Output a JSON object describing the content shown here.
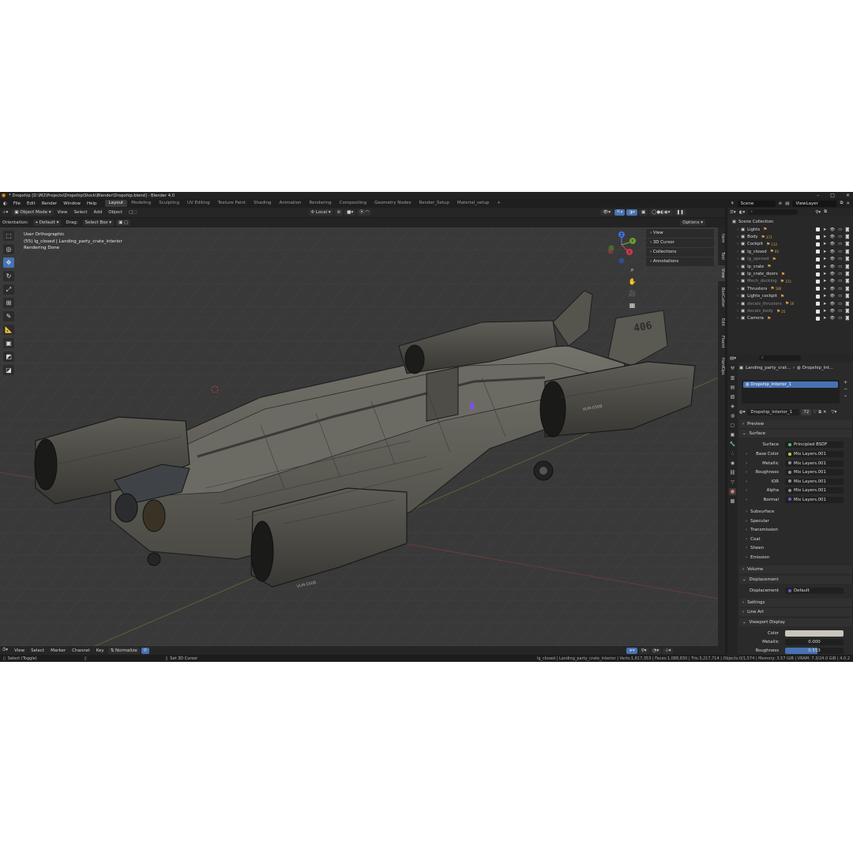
{
  "titlebar": {
    "title": "* Dropship [D:\\M2\\Projects\\Dropship\\Stock\\Blender\\Dropship.blend] - Blender 4.0"
  },
  "menu": [
    "File",
    "Edit",
    "Render",
    "Window",
    "Help"
  ],
  "workspaces": [
    "Layout",
    "Modeling",
    "Sculpting",
    "UV Editing",
    "Texture Paint",
    "Shading",
    "Animation",
    "Rendering",
    "Compositing",
    "Geometry Nodes",
    "Render_Setup",
    "Material_setup"
  ],
  "active_workspace": "Layout",
  "scene": {
    "scene_name": "Scene",
    "view_layer": "ViewLayer"
  },
  "header": {
    "mode": "Object Mode",
    "view": "View",
    "select": "Select",
    "add": "Add",
    "object": "Object",
    "pivot": "Local",
    "options": "Options"
  },
  "header2": {
    "orientation_label": "Orientation:",
    "orientation": "Default",
    "drag_label": "Drag:",
    "drag": "Select Box"
  },
  "viewport": {
    "info_line1": "User Orthographic",
    "info_line2": "(55) lg_closed | Landing_party_crate_interior",
    "info_line3": "Rendering Done",
    "hull_text_1": "406",
    "hull_text_2": "406",
    "hull_text_3": "VLM-5508",
    "hull_text_4": "VLM-5508",
    "gizmo_axes": {
      "z": "Z",
      "y": "Y",
      "x": "X"
    },
    "npanel": [
      "View",
      "3D Cursor",
      "Collections",
      "Annotations"
    ],
    "side_tabs": [
      "Item",
      "Tool",
      "View",
      "BoxCutter",
      "Edit",
      "Fluent",
      "HardOps"
    ]
  },
  "outliner": {
    "root": "Scene Collection",
    "items": [
      {
        "name": "Lights",
        "count": "",
        "dim": false
      },
      {
        "name": "Body",
        "count": "373",
        "dim": false
      },
      {
        "name": "Cockpit",
        "count": "112",
        "dim": false
      },
      {
        "name": "lg_closed",
        "count": "82",
        "dim": false
      },
      {
        "name": "lg_opened",
        "count": "",
        "dim": true
      },
      {
        "name": "lp_crate",
        "count": "",
        "dim": false
      },
      {
        "name": "lp_crate_doors",
        "count": "",
        "dim": false
      },
      {
        "name": "Mech_docking",
        "count": "373",
        "dim": true
      },
      {
        "name": "Thrusters",
        "count": "180",
        "dim": false
      },
      {
        "name": "Lights_cockpit",
        "count": "",
        "dim": false
      },
      {
        "name": "decals_thrusters",
        "count": "16",
        "dim": true
      },
      {
        "name": "decals_body",
        "count": "25",
        "dim": true
      },
      {
        "name": "Camera",
        "count": "",
        "dim": false
      }
    ]
  },
  "properties": {
    "breadcrumb_obj": "Landing_party_crat...",
    "breadcrumb_mat": "Dropship_Int...",
    "slot": "Dropship_Interior_1",
    "material_name": "Dropship_Interior_1",
    "users": "72",
    "sections": {
      "preview": "Preview",
      "surface": "Surface",
      "volume": "Volume",
      "displacement": "Displacement",
      "settings": "Settings",
      "line_art": "Line Art",
      "viewport_display": "Viewport Display"
    },
    "surface_label": "Surface",
    "surface_value": "Principled BSDF",
    "inputs": [
      {
        "label": "Base Color",
        "value": "Mix Layers.001",
        "color": "#c9c93a"
      },
      {
        "label": "Metallic",
        "value": "Mix Layers.001",
        "color": "#8f8f8f"
      },
      {
        "label": "Roughness",
        "value": "Mix Layers.001",
        "color": "#8f8f8f"
      },
      {
        "label": "IOR",
        "value": "Mix Layers.001",
        "color": "#8f8f8f"
      },
      {
        "label": "Alpha",
        "value": "Mix Layers.001",
        "color": "#8f8f8f"
      },
      {
        "label": "Normal",
        "value": "Mix Layers.001",
        "color": "#6363c7"
      }
    ],
    "subsections": [
      "Subsurface",
      "Specular",
      "Transmission",
      "Coat",
      "Sheen",
      "Emission"
    ],
    "displacement_label": "Displacement",
    "displacement_value": "Default",
    "vd_color_label": "Color",
    "vd_metallic_label": "Metallic",
    "vd_metallic_value": "0.000",
    "vd_roughness_label": "Roughness",
    "vd_roughness_value": "0.553",
    "vd_roughness_fraction": 0.553
  },
  "timeline": {
    "view": "View",
    "select": "Select",
    "marker": "Marker",
    "channel": "Channel",
    "key": "Key",
    "normalize": "Normalize"
  },
  "status": {
    "left1": "Select (Toggle)",
    "left2": "Set 3D Cursor",
    "right": "lg_closed | Landing_party_crate_interior | Verts:1,617,353 | Faces:1,088,830 | Tris:3,217,714 | Objects:0/1,574 | Memory: 3.57 GiB | VRAM: 7.3/24.0 GiB | 4.0.2"
  },
  "colors": {
    "accent": "#4772b3",
    "grid": "#393939",
    "hull": "#5b5a52",
    "hull_dark": "#2d2d2b"
  }
}
